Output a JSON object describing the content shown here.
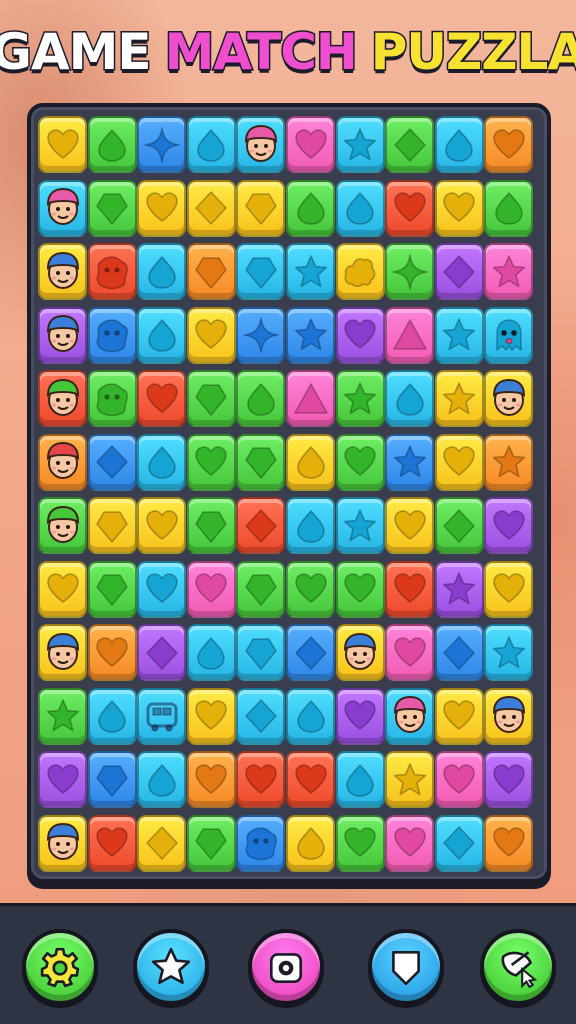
{
  "title": {
    "word1": "GAME",
    "word2": "MATCH",
    "word3": "PUZZLA"
  },
  "palette": {
    "yellow": "#f8c21c",
    "green": "#46c63a",
    "blue": "#2e86e8",
    "cyan": "#27b6e6",
    "pink": "#f25bb2",
    "purple": "#9a4fe0",
    "red": "#ee4a2c",
    "orange": "#f68a25"
  },
  "board": {
    "rows": [
      [
        [
          "yellow",
          "heart"
        ],
        [
          "green",
          "drop"
        ],
        [
          "blue",
          "star4"
        ],
        [
          "cyan",
          "drop"
        ],
        [
          "cyan",
          "face"
        ],
        [
          "pink",
          "heart"
        ],
        [
          "cyan",
          "star"
        ],
        [
          "green",
          "diamond"
        ],
        [
          "cyan",
          "drop"
        ],
        [
          "orange",
          "heart"
        ]
      ],
      [
        [
          "cyan",
          "face"
        ],
        [
          "green",
          "gem"
        ],
        [
          "yellow",
          "heart"
        ],
        [
          "yellow",
          "diamond"
        ],
        [
          "yellow",
          "gem"
        ],
        [
          "green",
          "drop"
        ],
        [
          "cyan",
          "drop"
        ],
        [
          "red",
          "heart"
        ],
        [
          "yellow",
          "heart"
        ],
        [
          "green",
          "drop"
        ]
      ],
      [
        [
          "yellow",
          "face"
        ],
        [
          "red",
          "blob"
        ],
        [
          "cyan",
          "drop"
        ],
        [
          "orange",
          "gem"
        ],
        [
          "cyan",
          "gem"
        ],
        [
          "cyan",
          "star"
        ],
        [
          "yellow",
          "cloud"
        ],
        [
          "green",
          "star4"
        ],
        [
          "purple",
          "diamond"
        ],
        [
          "pink",
          "star"
        ]
      ],
      [
        [
          "purple",
          "face"
        ],
        [
          "blue",
          "blob"
        ],
        [
          "cyan",
          "drop"
        ],
        [
          "yellow",
          "heart"
        ],
        [
          "blue",
          "star4"
        ],
        [
          "blue",
          "star"
        ],
        [
          "purple",
          "heart"
        ],
        [
          "pink",
          "triangle"
        ],
        [
          "cyan",
          "star"
        ],
        [
          "cyan",
          "ghost"
        ]
      ],
      [
        [
          "red",
          "face"
        ],
        [
          "green",
          "blob"
        ],
        [
          "red",
          "heart"
        ],
        [
          "green",
          "gem"
        ],
        [
          "green",
          "drop"
        ],
        [
          "pink",
          "triangle"
        ],
        [
          "green",
          "star"
        ],
        [
          "cyan",
          "drop"
        ],
        [
          "yellow",
          "star"
        ],
        [
          "yellow",
          "face"
        ]
      ],
      [
        [
          "orange",
          "face"
        ],
        [
          "blue",
          "diamond"
        ],
        [
          "cyan",
          "drop"
        ],
        [
          "green",
          "heart"
        ],
        [
          "green",
          "gem"
        ],
        [
          "yellow",
          "drop"
        ],
        [
          "green",
          "heart"
        ],
        [
          "blue",
          "star"
        ],
        [
          "yellow",
          "heart"
        ],
        [
          "orange",
          "star"
        ]
      ],
      [
        [
          "green",
          "face"
        ],
        [
          "yellow",
          "gem"
        ],
        [
          "yellow",
          "heart"
        ],
        [
          "green",
          "gem"
        ],
        [
          "red",
          "diamond"
        ],
        [
          "cyan",
          "drop"
        ],
        [
          "cyan",
          "star"
        ],
        [
          "yellow",
          "heart"
        ],
        [
          "green",
          "diamond"
        ],
        [
          "purple",
          "heart"
        ]
      ],
      [
        [
          "yellow",
          "heart"
        ],
        [
          "green",
          "gem"
        ],
        [
          "cyan",
          "heart"
        ],
        [
          "pink",
          "heart"
        ],
        [
          "green",
          "gem"
        ],
        [
          "green",
          "heart"
        ],
        [
          "green",
          "heart"
        ],
        [
          "red",
          "heart"
        ],
        [
          "purple",
          "star"
        ],
        [
          "yellow",
          "heart"
        ]
      ],
      [
        [
          "yellow",
          "face"
        ],
        [
          "orange",
          "heart"
        ],
        [
          "purple",
          "diamond"
        ],
        [
          "cyan",
          "drop"
        ],
        [
          "cyan",
          "gem"
        ],
        [
          "blue",
          "diamond"
        ],
        [
          "yellow",
          "face"
        ],
        [
          "pink",
          "heart"
        ],
        [
          "blue",
          "diamond"
        ],
        [
          "cyan",
          "star"
        ]
      ],
      [
        [
          "green",
          "star"
        ],
        [
          "cyan",
          "drop"
        ],
        [
          "cyan",
          "bus"
        ],
        [
          "yellow",
          "heart"
        ],
        [
          "cyan",
          "diamond"
        ],
        [
          "cyan",
          "drop"
        ],
        [
          "purple",
          "heart"
        ],
        [
          "cyan",
          "face"
        ],
        [
          "yellow",
          "heart"
        ],
        [
          "yellow",
          "face"
        ]
      ],
      [
        [
          "purple",
          "heart"
        ],
        [
          "blue",
          "gem"
        ],
        [
          "cyan",
          "drop"
        ],
        [
          "orange",
          "heart"
        ],
        [
          "red",
          "heart"
        ],
        [
          "red",
          "heart"
        ],
        [
          "cyan",
          "drop"
        ],
        [
          "yellow",
          "star"
        ],
        [
          "pink",
          "heart"
        ],
        [
          "purple",
          "heart"
        ]
      ],
      [
        [
          "yellow",
          "face"
        ],
        [
          "red",
          "heart"
        ],
        [
          "yellow",
          "diamond"
        ],
        [
          "green",
          "gem"
        ],
        [
          "blue",
          "blob"
        ],
        [
          "yellow",
          "drop"
        ],
        [
          "green",
          "heart"
        ],
        [
          "pink",
          "heart"
        ],
        [
          "cyan",
          "diamond"
        ],
        [
          "orange",
          "heart"
        ]
      ]
    ]
  },
  "toolbar": [
    {
      "name": "settings-button",
      "icon": "gear-icon",
      "color": "#4cd23c"
    },
    {
      "name": "favorites-button",
      "icon": "star-icon",
      "color": "#2fb4ea"
    },
    {
      "name": "camera-button",
      "icon": "camera-icon",
      "color": "#ef4fc4"
    },
    {
      "name": "shield-button",
      "icon": "shield-icon",
      "color": "#2fa6ea"
    },
    {
      "name": "satellite-button",
      "icon": "satellite-icon",
      "color": "#4cd23c"
    }
  ]
}
